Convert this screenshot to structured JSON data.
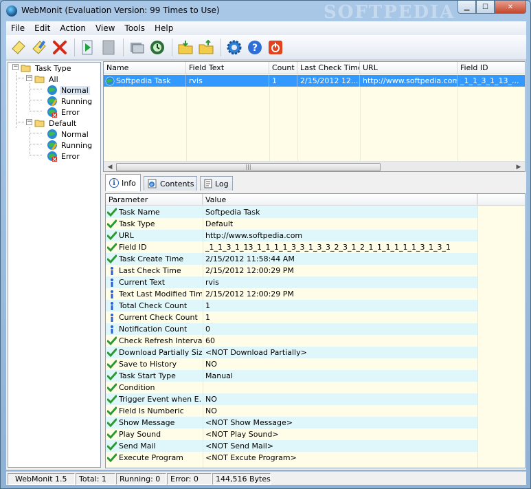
{
  "window": {
    "title": "WebMonit (Evaluation Version: 99 Times to Use)",
    "watermark": "SOFTPEDIA"
  },
  "menu": [
    "File",
    "Edit",
    "Action",
    "View",
    "Tools",
    "Help"
  ],
  "toolbar": {
    "icons": [
      "new-task-icon",
      "edit-task-icon",
      "delete-icon",
      "start-icon",
      "stop-icon",
      "check-all-icon",
      "check-now-icon",
      "import-icon",
      "export-icon",
      "settings-icon",
      "help-icon",
      "exit-icon"
    ]
  },
  "tree": {
    "root": "Task Type",
    "groups": [
      {
        "label": "All",
        "children": [
          "Normal",
          "Running",
          "Error"
        ]
      },
      {
        "label": "Default",
        "children": [
          "Normal",
          "Running",
          "Error"
        ]
      }
    ]
  },
  "task_grid": {
    "columns": [
      "Name",
      "Field Text",
      "Count",
      "Last Check Time",
      "URL",
      "Field ID"
    ],
    "rows": [
      [
        "Softpedia Task",
        "rvis",
        "1",
        "2/15/2012 12...",
        "http://www.softpedia.com",
        "_1_1_3_1_13_..."
      ]
    ]
  },
  "tabs": [
    "Info",
    "Contents",
    "Log"
  ],
  "params": {
    "columns": [
      "Parameter",
      "Value"
    ],
    "rows": [
      {
        "icon": "check",
        "name": "Task Name",
        "value": "Softpedia Task"
      },
      {
        "icon": "check",
        "name": "Task Type",
        "value": "Default"
      },
      {
        "icon": "check",
        "name": "URL",
        "value": "http://www.softpedia.com"
      },
      {
        "icon": "check",
        "name": "Field ID",
        "value": "_1_1_3_1_13_1_1_1_1_3_3_1_3_3_2_3_1_2_1_1_1_1_1_1_3_1_3_1"
      },
      {
        "icon": "check",
        "name": "Task Create Time",
        "value": "2/15/2012 11:58:44 AM"
      },
      {
        "icon": "info",
        "name": "Last Check Time",
        "value": "2/15/2012 12:00:29 PM"
      },
      {
        "icon": "info",
        "name": "Current Text",
        "value": "rvis"
      },
      {
        "icon": "info",
        "name": "Text Last Modified Time",
        "value": "2/15/2012 12:00:29 PM"
      },
      {
        "icon": "info",
        "name": "Total Check Count",
        "value": "1"
      },
      {
        "icon": "info",
        "name": "Current Check Count",
        "value": "1"
      },
      {
        "icon": "info",
        "name": "Notification Count",
        "value": "0"
      },
      {
        "icon": "check",
        "name": "Check Refresh Interval",
        "value": "60"
      },
      {
        "icon": "check",
        "name": "Download Partially Size",
        "value": "<NOT Download Partially>"
      },
      {
        "icon": "check",
        "name": "Save to History",
        "value": "NO"
      },
      {
        "icon": "check",
        "name": "Task Start Type",
        "value": "Manual"
      },
      {
        "icon": "check",
        "name": "Condition",
        "value": ""
      },
      {
        "icon": "check",
        "name": "Trigger Event when E...",
        "value": "NO"
      },
      {
        "icon": "check",
        "name": "Field Is Numberic",
        "value": "NO"
      },
      {
        "icon": "check",
        "name": "Show Message",
        "value": "<NOT Show Message>"
      },
      {
        "icon": "check",
        "name": "Play Sound",
        "value": "<NOT Play Sound>"
      },
      {
        "icon": "check",
        "name": "Send Mail",
        "value": "<NOT Send Mail>"
      },
      {
        "icon": "check",
        "name": "Execute Program",
        "value": "<NOT Excute Program>"
      }
    ]
  },
  "status": {
    "version": "WebMonit 1.5",
    "total": "Total: 1",
    "running": "Running: 0",
    "error": "Error: 0",
    "bytes": "144,516 Bytes"
  },
  "colors": {
    "selection": "#3399ff",
    "row_alt": "#dff7fb",
    "row_base": "#fffde8"
  }
}
